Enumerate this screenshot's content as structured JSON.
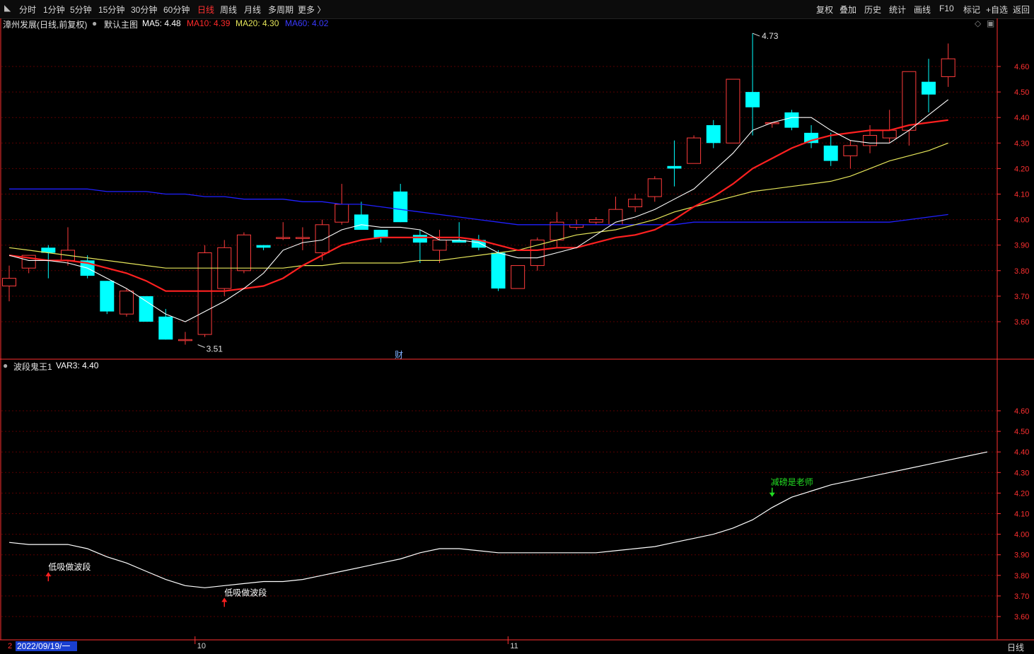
{
  "toolbar": {
    "periods": [
      "分时",
      "1分钟",
      "5分钟",
      "15分钟",
      "30分钟",
      "60分钟",
      "日线",
      "周线",
      "月线",
      "多周期",
      "更多 〉"
    ],
    "active_period": "日线",
    "right_buttons": [
      "复权",
      "叠加",
      "历史",
      "统计",
      "画线",
      "F10",
      "标记",
      "+自选",
      "返回"
    ]
  },
  "main_info": {
    "stock": "漳州发展(日线,前复权)",
    "template": "默认主图",
    "ma5": "MA5: 4.48",
    "ma10": "MA10: 4.39",
    "ma20": "MA20: 4.30",
    "ma60": "MA60: 4.02"
  },
  "sub_info": {
    "indicator": "波段鬼王1",
    "var3": "VAR3: 4.40"
  },
  "colors": {
    "up": "#ff3c3c",
    "down": "#00ffff",
    "ma5": "#ffffff",
    "ma10": "#ff2020",
    "ma20": "#e6e65a",
    "ma60": "#2020ff",
    "grid": "#5a0000",
    "axis": "#ff3030"
  },
  "chart_data": [
    {
      "type": "candlestick",
      "ylim": [
        3.48,
        4.76
      ],
      "yticks": [
        "4.60",
        "4.50",
        "4.40",
        "4.30",
        "4.20",
        "4.10",
        "4.00",
        "3.90",
        "3.80",
        "3.70",
        "3.60"
      ],
      "high_label": "4.73",
      "low_label": "3.51",
      "event_marker": "财",
      "candles": [
        {
          "o": 3.74,
          "h": 3.82,
          "l": 3.68,
          "c": 3.77
        },
        {
          "o": 3.81,
          "h": 3.86,
          "l": 3.79,
          "c": 3.86
        },
        {
          "o": 3.89,
          "h": 3.9,
          "l": 3.77,
          "c": 3.87
        },
        {
          "o": 3.84,
          "h": 3.97,
          "l": 3.82,
          "c": 3.88
        },
        {
          "o": 3.84,
          "h": 3.86,
          "l": 3.77,
          "c": 3.78
        },
        {
          "o": 3.76,
          "h": 3.76,
          "l": 3.63,
          "c": 3.64
        },
        {
          "o": 3.63,
          "h": 3.73,
          "l": 3.62,
          "c": 3.72
        },
        {
          "o": 3.7,
          "h": 3.7,
          "l": 3.6,
          "c": 3.6
        },
        {
          "o": 3.62,
          "h": 3.65,
          "l": 3.53,
          "c": 3.53
        },
        {
          "o": 3.53,
          "h": 3.56,
          "l": 3.51,
          "c": 3.53
        },
        {
          "o": 3.55,
          "h": 3.9,
          "l": 3.54,
          "c": 3.87
        },
        {
          "o": 3.73,
          "h": 3.92,
          "l": 3.7,
          "c": 3.89
        },
        {
          "o": 3.8,
          "h": 3.95,
          "l": 3.79,
          "c": 3.94
        },
        {
          "o": 3.9,
          "h": 3.9,
          "l": 3.88,
          "c": 3.89
        },
        {
          "o": 3.93,
          "h": 3.99,
          "l": 3.92,
          "c": 3.93
        },
        {
          "o": 3.93,
          "h": 3.97,
          "l": 3.88,
          "c": 3.93
        },
        {
          "o": 3.87,
          "h": 4.0,
          "l": 3.84,
          "c": 3.98
        },
        {
          "o": 3.99,
          "h": 4.14,
          "l": 3.98,
          "c": 4.06
        },
        {
          "o": 4.02,
          "h": 4.07,
          "l": 3.96,
          "c": 3.96
        },
        {
          "o": 3.96,
          "h": 3.95,
          "l": 3.91,
          "c": 3.93
        },
        {
          "o": 4.11,
          "h": 4.14,
          "l": 3.99,
          "c": 3.99
        },
        {
          "o": 3.94,
          "h": 3.96,
          "l": 3.83,
          "c": 3.91
        },
        {
          "o": 3.88,
          "h": 3.96,
          "l": 3.83,
          "c": 3.92
        },
        {
          "o": 3.92,
          "h": 3.99,
          "l": 3.92,
          "c": 3.91
        },
        {
          "o": 3.92,
          "h": 3.94,
          "l": 3.88,
          "c": 3.89
        },
        {
          "o": 3.87,
          "h": 3.88,
          "l": 3.72,
          "c": 3.73
        },
        {
          "o": 3.73,
          "h": 3.82,
          "l": 3.73,
          "c": 3.82
        },
        {
          "o": 3.82,
          "h": 3.93,
          "l": 3.8,
          "c": 3.92
        },
        {
          "o": 3.92,
          "h": 4.03,
          "l": 3.89,
          "c": 3.99
        },
        {
          "o": 3.97,
          "h": 4.0,
          "l": 3.96,
          "c": 3.98
        },
        {
          "o": 3.99,
          "h": 4.01,
          "l": 3.98,
          "c": 4.0
        },
        {
          "o": 3.98,
          "h": 4.09,
          "l": 3.98,
          "c": 4.04
        },
        {
          "o": 4.05,
          "h": 4.1,
          "l": 4.03,
          "c": 4.08
        },
        {
          "o": 4.09,
          "h": 4.17,
          "l": 4.07,
          "c": 4.16
        },
        {
          "o": 4.21,
          "h": 4.31,
          "l": 4.13,
          "c": 4.2
        },
        {
          "o": 4.22,
          "h": 4.33,
          "l": 4.22,
          "c": 4.32
        },
        {
          "o": 4.37,
          "h": 4.39,
          "l": 4.28,
          "c": 4.3
        },
        {
          "o": 4.3,
          "h": 4.55,
          "l": 4.3,
          "c": 4.55
        },
        {
          "o": 4.5,
          "h": 4.73,
          "l": 4.33,
          "c": 4.44
        },
        {
          "o": 4.38,
          "h": 4.38,
          "l": 4.36,
          "c": 4.38
        },
        {
          "o": 4.42,
          "h": 4.43,
          "l": 4.35,
          "c": 4.36
        },
        {
          "o": 4.34,
          "h": 4.37,
          "l": 4.28,
          "c": 4.3
        },
        {
          "o": 4.29,
          "h": 4.34,
          "l": 4.21,
          "c": 4.23
        },
        {
          "o": 4.25,
          "h": 4.31,
          "l": 4.2,
          "c": 4.29
        },
        {
          "o": 4.29,
          "h": 4.37,
          "l": 4.26,
          "c": 4.33
        },
        {
          "o": 4.32,
          "h": 4.43,
          "l": 4.3,
          "c": 4.35
        },
        {
          "o": 4.35,
          "h": 4.58,
          "l": 4.29,
          "c": 4.58
        },
        {
          "o": 4.54,
          "h": 4.63,
          "l": 4.42,
          "c": 4.49
        },
        {
          "o": 4.56,
          "h": 4.69,
          "l": 4.52,
          "c": 4.63
        }
      ],
      "ma5": [
        3.86,
        3.84,
        3.84,
        3.83,
        3.81,
        3.77,
        3.73,
        3.68,
        3.63,
        3.6,
        3.64,
        3.68,
        3.73,
        3.79,
        3.88,
        3.91,
        3.92,
        3.96,
        3.98,
        3.97,
        3.97,
        3.96,
        3.92,
        3.92,
        3.91,
        3.87,
        3.85,
        3.85,
        3.87,
        3.89,
        3.94,
        3.99,
        4.01,
        4.04,
        4.08,
        4.12,
        4.19,
        4.26,
        4.35,
        4.38,
        4.4,
        4.4,
        4.35,
        4.31,
        4.3,
        4.3,
        4.35,
        4.41,
        4.47
      ],
      "ma10": [
        3.86,
        3.85,
        3.84,
        3.84,
        3.83,
        3.81,
        3.79,
        3.76,
        3.72,
        3.72,
        3.72,
        3.72,
        3.73,
        3.74,
        3.77,
        3.82,
        3.86,
        3.9,
        3.92,
        3.93,
        3.93,
        3.93,
        3.93,
        3.93,
        3.92,
        3.9,
        3.88,
        3.88,
        3.89,
        3.89,
        3.91,
        3.93,
        3.94,
        3.96,
        4.0,
        4.05,
        4.09,
        4.14,
        4.2,
        4.24,
        4.28,
        4.31,
        4.33,
        4.34,
        4.35,
        4.35,
        4.37,
        4.38,
        4.39
      ],
      "ma20": [
        3.89,
        3.88,
        3.87,
        3.86,
        3.85,
        3.84,
        3.83,
        3.82,
        3.81,
        3.81,
        3.81,
        3.81,
        3.81,
        3.81,
        3.81,
        3.82,
        3.82,
        3.83,
        3.83,
        3.83,
        3.83,
        3.84,
        3.84,
        3.85,
        3.86,
        3.87,
        3.88,
        3.9,
        3.92,
        3.94,
        3.95,
        3.96,
        3.98,
        4.0,
        4.03,
        4.05,
        4.07,
        4.09,
        4.11,
        4.12,
        4.13,
        4.14,
        4.15,
        4.17,
        4.2,
        4.23,
        4.25,
        4.27,
        4.3
      ],
      "ma60": [
        4.12,
        4.12,
        4.12,
        4.12,
        4.12,
        4.11,
        4.11,
        4.11,
        4.1,
        4.1,
        4.09,
        4.09,
        4.08,
        4.08,
        4.08,
        4.07,
        4.07,
        4.06,
        4.06,
        4.05,
        4.04,
        4.03,
        4.02,
        4.01,
        4.0,
        3.99,
        3.98,
        3.98,
        3.98,
        3.98,
        3.98,
        3.98,
        3.98,
        3.98,
        3.98,
        3.99,
        3.99,
        3.99,
        3.99,
        3.99,
        3.99,
        3.99,
        3.99,
        3.99,
        3.99,
        3.99,
        4.0,
        4.01,
        4.02
      ]
    },
    {
      "type": "line",
      "ylim": [
        3.55,
        4.73
      ],
      "yticks": [
        "4.60",
        "4.50",
        "4.40",
        "4.30",
        "4.20",
        "4.10",
        "4.00",
        "3.90",
        "3.80",
        "3.70",
        "3.60"
      ],
      "var3": [
        3.96,
        3.95,
        3.95,
        3.95,
        3.93,
        3.89,
        3.86,
        3.82,
        3.78,
        3.75,
        3.74,
        3.75,
        3.76,
        3.77,
        3.77,
        3.78,
        3.8,
        3.82,
        3.84,
        3.86,
        3.88,
        3.91,
        3.93,
        3.93,
        3.92,
        3.91,
        3.91,
        3.91,
        3.91,
        3.91,
        3.91,
        3.92,
        3.93,
        3.94,
        3.96,
        3.98,
        4.0,
        4.03,
        4.07,
        4.13,
        4.18,
        4.21,
        4.24,
        4.26,
        4.28,
        4.3,
        4.32,
        4.34,
        4.36,
        4.38,
        4.4
      ],
      "signals": [
        {
          "type": "buy",
          "index": 2,
          "label": "低吸做波段"
        },
        {
          "type": "buy",
          "index": 11,
          "label": "低吸做波段"
        },
        {
          "type": "sell",
          "index": 39,
          "label": "减磅是老师"
        }
      ]
    }
  ],
  "xaxis": {
    "date_label": "2022/09/19/一",
    "left_stub": "2",
    "month_ticks": [
      {
        "label": "10",
        "index": 10
      },
      {
        "label": "11",
        "index": 26
      }
    ],
    "period_label": "日线"
  }
}
